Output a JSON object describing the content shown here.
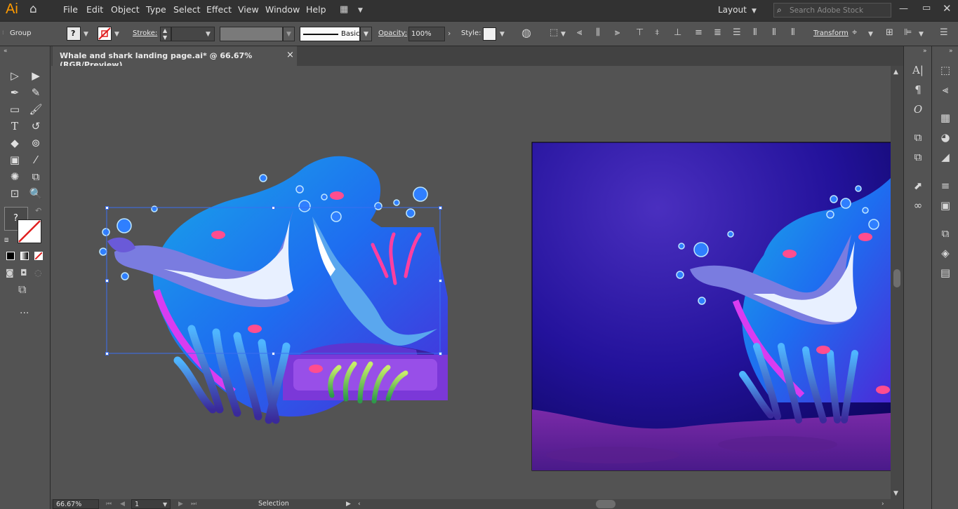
{
  "app": {
    "logo": "Ai"
  },
  "menu": {
    "items": [
      "File",
      "Edit",
      "Object",
      "Type",
      "Select",
      "Effect",
      "View",
      "Window",
      "Help"
    ]
  },
  "workspace": {
    "label": "Layout"
  },
  "search": {
    "placeholder": "Search Adobe Stock"
  },
  "control": {
    "selection_type": "Group",
    "fill_label": "?",
    "stroke_label": "Stroke:",
    "brush_label": "Basic",
    "opacity_label": "Opacity:",
    "opacity_value": "100%",
    "style_label": "Style:",
    "transform_label": "Transform"
  },
  "document": {
    "tab_title": "Whale and shark landing page.ai* @ 66.67% (RGB/Preview)",
    "close": "×"
  },
  "tools": {
    "unknown_fill": "?",
    "more": "..."
  },
  "status": {
    "zoom": "66.67%",
    "artboard": "1",
    "mode": "Selection"
  },
  "colors": {
    "accent": "#ff9a00",
    "selection": "#3b6ff0",
    "ui_dark": "#323232",
    "ui_mid": "#535353"
  }
}
